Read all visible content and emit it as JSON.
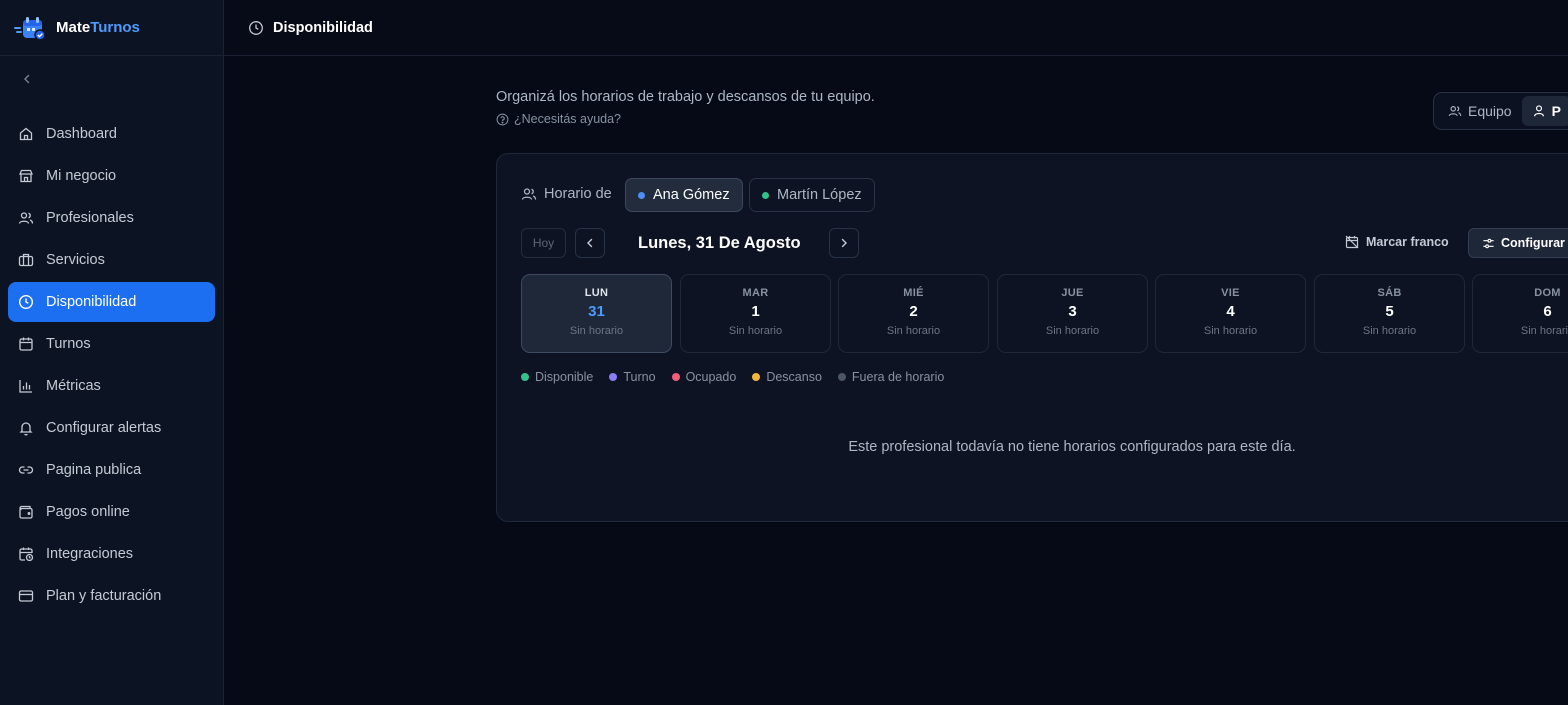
{
  "brand": {
    "name_part1": "Mate",
    "name_part2": "Turnos"
  },
  "colors": {
    "accent": "#1d6ff2",
    "brand_accent": "#4d9bff"
  },
  "sidebar": {
    "items": [
      {
        "label": "Dashboard",
        "icon": "home-icon"
      },
      {
        "label": "Mi negocio",
        "icon": "store-icon"
      },
      {
        "label": "Profesionales",
        "icon": "users-icon"
      },
      {
        "label": "Servicios",
        "icon": "briefcase-icon"
      },
      {
        "label": "Disponibilidad",
        "icon": "clock-icon",
        "active": true
      },
      {
        "label": "Turnos",
        "icon": "calendar-icon"
      },
      {
        "label": "Métricas",
        "icon": "bar-chart-icon"
      },
      {
        "label": "Configurar alertas",
        "icon": "bell-icon"
      },
      {
        "label": "Pagina publica",
        "icon": "link-icon"
      },
      {
        "label": "Pagos online",
        "icon": "wallet-icon"
      },
      {
        "label": "Integraciones",
        "icon": "calendar-clock-icon"
      },
      {
        "label": "Plan y facturación",
        "icon": "credit-card-icon"
      }
    ]
  },
  "header": {
    "title": "Disponibilidad"
  },
  "main": {
    "subtitle": "Organizá los horarios de trabajo y descansos de tu equipo.",
    "help": "¿Necesitás ayuda?",
    "view_toggle": {
      "team": "Equipo",
      "professional": "P"
    },
    "schedule_of": "Horario de",
    "professionals": [
      {
        "name": "Ana Gómez",
        "color": "#4d8ff7",
        "active": true
      },
      {
        "name": "Martín López",
        "color": "#34c08a",
        "active": false
      }
    ],
    "today": "Hoy",
    "date_title": "Lunes, 31 De Agosto",
    "mark_off": "Marcar franco",
    "configure": "Configurar j",
    "days": [
      {
        "name": "LUN",
        "num": "31",
        "status": "Sin horario",
        "active": true
      },
      {
        "name": "MAR",
        "num": "1",
        "status": "Sin horario"
      },
      {
        "name": "MIÉ",
        "num": "2",
        "status": "Sin horario"
      },
      {
        "name": "JUE",
        "num": "3",
        "status": "Sin horario"
      },
      {
        "name": "VIE",
        "num": "4",
        "status": "Sin horario"
      },
      {
        "name": "SÁB",
        "num": "5",
        "status": "Sin horario"
      },
      {
        "name": "DOM",
        "num": "6",
        "status": "Sin horario"
      }
    ],
    "legend": [
      {
        "label": "Disponible",
        "color": "#34c08a"
      },
      {
        "label": "Turno",
        "color": "#8b7cf6"
      },
      {
        "label": "Ocupado",
        "color": "#f0607a"
      },
      {
        "label": "Descanso",
        "color": "#f2b63c"
      },
      {
        "label": "Fuera de horario",
        "color": "#4b5563"
      }
    ],
    "empty_message": "Este profesional todavía no tiene horarios configurados para este día."
  }
}
